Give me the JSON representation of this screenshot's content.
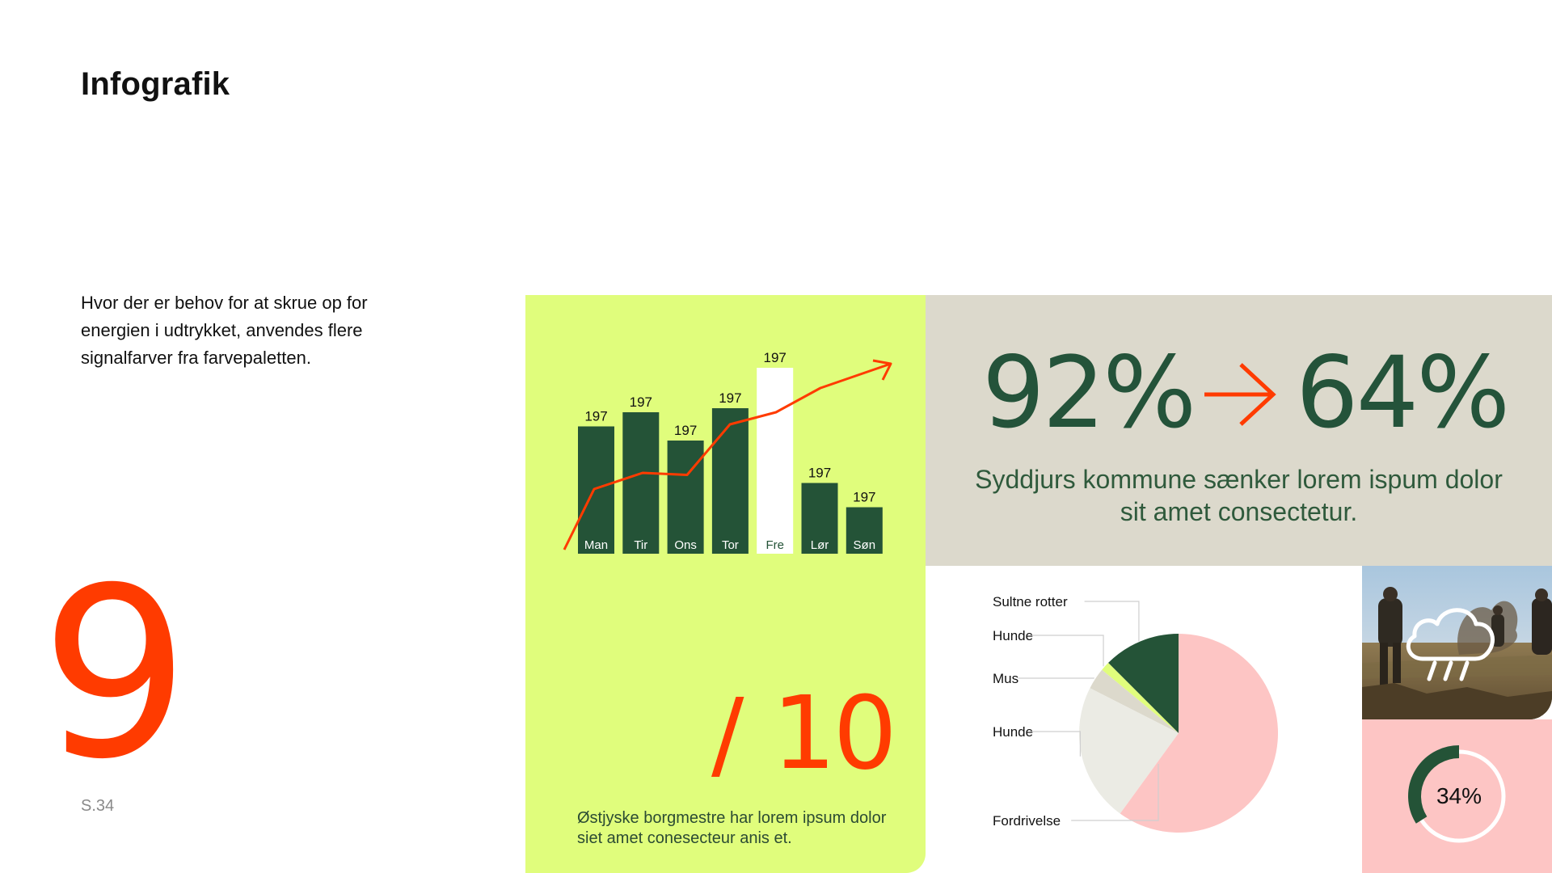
{
  "page": {
    "title": "Infografik",
    "intro": "Hvor der er behov for at skrue op for energien i udtrykket, anvendes flere signalfarver fra farvepaletten.",
    "page_number": "S.34"
  },
  "colors": {
    "lime": "#e0fd7c",
    "dark_green": "#245337",
    "signal_red": "#ff3b00",
    "warm_grey": "#dcd9cc",
    "pink": "#fdc5c4",
    "light_grey": "#ebebe4"
  },
  "chart_data": [
    {
      "type": "bar",
      "categories": [
        "Man",
        "Tir",
        "Ons",
        "Tor",
        "Fre",
        "Lør",
        "Søn"
      ],
      "values": [
        63,
        70,
        56,
        72,
        92,
        35,
        23
      ],
      "data_labels": [
        "197",
        "197",
        "197",
        "197",
        "197",
        "197",
        "197"
      ],
      "highlight_category": "Fre",
      "trend_line": [
        2,
        32,
        40,
        39,
        64,
        70,
        82,
        94
      ],
      "ylim": [
        0,
        100
      ],
      "title": "",
      "xlabel": "",
      "ylabel": ""
    },
    {
      "type": "pie",
      "labels": [
        "Sultne rotter",
        "Hunde",
        "Mus",
        "Hunde",
        "Fordrivelse"
      ],
      "values": [
        12.5,
        1.5,
        3.5,
        22.5,
        60
      ],
      "colors": [
        "#245337",
        "#e0fd7c",
        "#dcd9cc",
        "#ebebe4",
        "#fdc5c4"
      ],
      "title": ""
    },
    {
      "type": "pie",
      "variant": "donut",
      "values": [
        34,
        66
      ],
      "center_label": "34%",
      "title": ""
    }
  ],
  "fraction": {
    "numerator": "9",
    "slash": "/",
    "denominator": "10",
    "caption": "Østjyske borgmestre har lorem ipsum dolor siet amet conesecteur anis et."
  },
  "stat": {
    "from": "92%",
    "to": "64%",
    "caption": "Syddjurs kommune sænker lorem ispum dolor sit amet consectetur."
  },
  "icons": {
    "trend_arrow": "arrow-up-right-icon",
    "stat_arrow": "arrow-right-icon",
    "weather": "cloud-rain-icon"
  }
}
